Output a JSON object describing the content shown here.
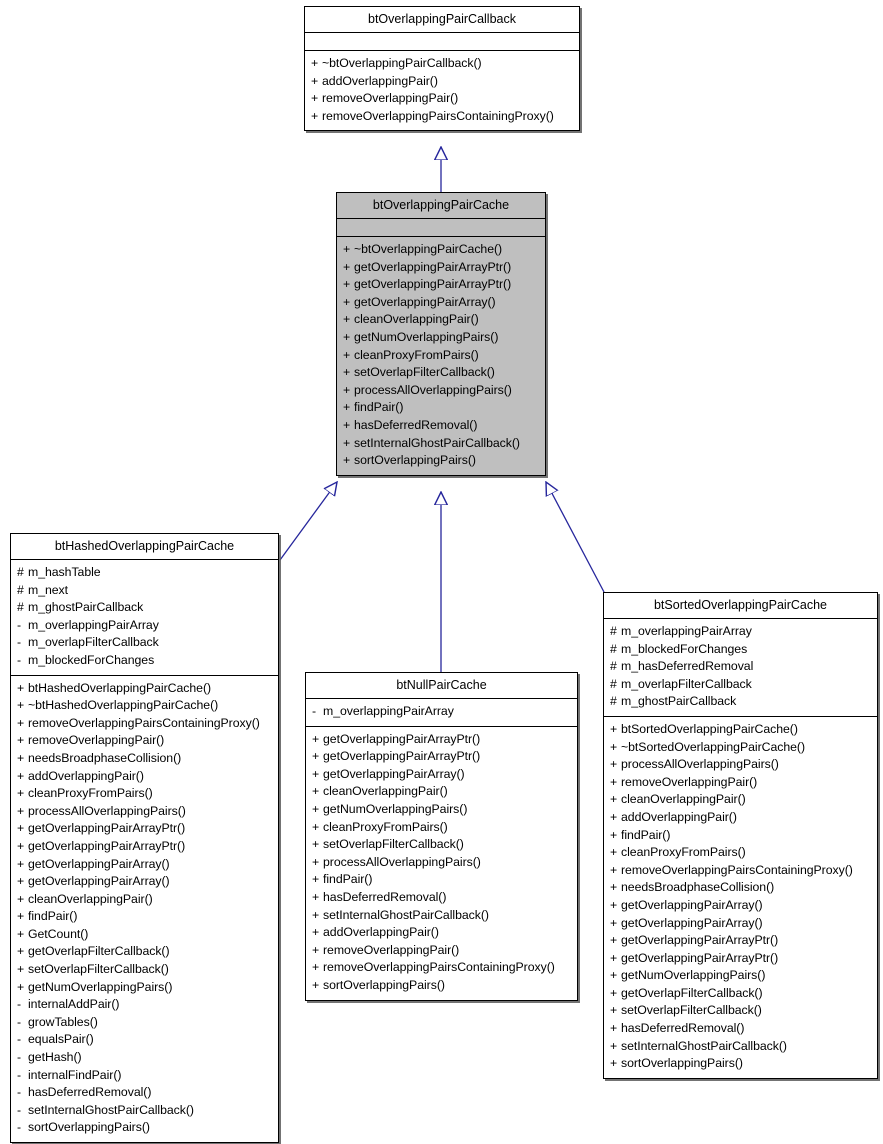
{
  "diagram": {
    "kind": "uml-class-inheritance-diagram",
    "background": "#ffffff",
    "edge_color": "#26269c",
    "highlight_fill": "#bfbfbf",
    "border_color": "#000000"
  },
  "classes": {
    "callback": {
      "name": "btOverlappingPairCallback",
      "attributes": [],
      "methods": [
        {
          "vis": "+",
          "label": "~btOverlappingPairCallback()"
        },
        {
          "vis": "+",
          "label": "addOverlappingPair()"
        },
        {
          "vis": "+",
          "label": "removeOverlappingPair()"
        },
        {
          "vis": "+",
          "label": "removeOverlappingPairsContainingProxy()"
        }
      ]
    },
    "cache": {
      "name": "btOverlappingPairCache",
      "attributes": [],
      "methods": [
        {
          "vis": "+",
          "label": "~btOverlappingPairCache()"
        },
        {
          "vis": "+",
          "label": "getOverlappingPairArrayPtr()"
        },
        {
          "vis": "+",
          "label": "getOverlappingPairArrayPtr()"
        },
        {
          "vis": "+",
          "label": "getOverlappingPairArray()"
        },
        {
          "vis": "+",
          "label": "cleanOverlappingPair()"
        },
        {
          "vis": "+",
          "label": "getNumOverlappingPairs()"
        },
        {
          "vis": "+",
          "label": "cleanProxyFromPairs()"
        },
        {
          "vis": "+",
          "label": "setOverlapFilterCallback()"
        },
        {
          "vis": "+",
          "label": "processAllOverlappingPairs()"
        },
        {
          "vis": "+",
          "label": "findPair()"
        },
        {
          "vis": "+",
          "label": "hasDeferredRemoval()"
        },
        {
          "vis": "+",
          "label": "setInternalGhostPairCallback()"
        },
        {
          "vis": "+",
          "label": "sortOverlappingPairs()"
        }
      ]
    },
    "hashed": {
      "name": "btHashedOverlappingPairCache",
      "attributes": [
        {
          "vis": "#",
          "label": "m_hashTable"
        },
        {
          "vis": "#",
          "label": "m_next"
        },
        {
          "vis": "#",
          "label": "m_ghostPairCallback"
        },
        {
          "vis": "-",
          "label": "m_overlappingPairArray"
        },
        {
          "vis": "-",
          "label": "m_overlapFilterCallback"
        },
        {
          "vis": "-",
          "label": "m_blockedForChanges"
        }
      ],
      "methods": [
        {
          "vis": "+",
          "label": "btHashedOverlappingPairCache()"
        },
        {
          "vis": "+",
          "label": "~btHashedOverlappingPairCache()"
        },
        {
          "vis": "+",
          "label": "removeOverlappingPairsContainingProxy()"
        },
        {
          "vis": "+",
          "label": "removeOverlappingPair()"
        },
        {
          "vis": "+",
          "label": "needsBroadphaseCollision()"
        },
        {
          "vis": "+",
          "label": "addOverlappingPair()"
        },
        {
          "vis": "+",
          "label": "cleanProxyFromPairs()"
        },
        {
          "vis": "+",
          "label": "processAllOverlappingPairs()"
        },
        {
          "vis": "+",
          "label": "getOverlappingPairArrayPtr()"
        },
        {
          "vis": "+",
          "label": "getOverlappingPairArrayPtr()"
        },
        {
          "vis": "+",
          "label": "getOverlappingPairArray()"
        },
        {
          "vis": "+",
          "label": "getOverlappingPairArray()"
        },
        {
          "vis": "+",
          "label": "cleanOverlappingPair()"
        },
        {
          "vis": "+",
          "label": "findPair()"
        },
        {
          "vis": "+",
          "label": "GetCount()"
        },
        {
          "vis": "+",
          "label": "getOverlapFilterCallback()"
        },
        {
          "vis": "+",
          "label": "setOverlapFilterCallback()"
        },
        {
          "vis": "+",
          "label": "getNumOverlappingPairs()"
        },
        {
          "vis": "-",
          "label": "internalAddPair()"
        },
        {
          "vis": "-",
          "label": "growTables()"
        },
        {
          "vis": "-",
          "label": "equalsPair()"
        },
        {
          "vis": "-",
          "label": "getHash()"
        },
        {
          "vis": "-",
          "label": "internalFindPair()"
        },
        {
          "vis": "-",
          "label": "hasDeferredRemoval()"
        },
        {
          "vis": "-",
          "label": "setInternalGhostPairCallback()"
        },
        {
          "vis": "-",
          "label": "sortOverlappingPairs()"
        }
      ]
    },
    "nullcache": {
      "name": "btNullPairCache",
      "attributes": [
        {
          "vis": "-",
          "label": "m_overlappingPairArray"
        }
      ],
      "methods": [
        {
          "vis": "+",
          "label": "getOverlappingPairArrayPtr()"
        },
        {
          "vis": "+",
          "label": "getOverlappingPairArrayPtr()"
        },
        {
          "vis": "+",
          "label": "getOverlappingPairArray()"
        },
        {
          "vis": "+",
          "label": "cleanOverlappingPair()"
        },
        {
          "vis": "+",
          "label": "getNumOverlappingPairs()"
        },
        {
          "vis": "+",
          "label": "cleanProxyFromPairs()"
        },
        {
          "vis": "+",
          "label": "setOverlapFilterCallback()"
        },
        {
          "vis": "+",
          "label": "processAllOverlappingPairs()"
        },
        {
          "vis": "+",
          "label": "findPair()"
        },
        {
          "vis": "+",
          "label": "hasDeferredRemoval()"
        },
        {
          "vis": "+",
          "label": "setInternalGhostPairCallback()"
        },
        {
          "vis": "+",
          "label": "addOverlappingPair()"
        },
        {
          "vis": "+",
          "label": "removeOverlappingPair()"
        },
        {
          "vis": "+",
          "label": "removeOverlappingPairsContainingProxy()"
        },
        {
          "vis": "+",
          "label": "sortOverlappingPairs()"
        }
      ]
    },
    "sorted": {
      "name": "btSortedOverlappingPairCache",
      "attributes": [
        {
          "vis": "#",
          "label": "m_overlappingPairArray"
        },
        {
          "vis": "#",
          "label": "m_blockedForChanges"
        },
        {
          "vis": "#",
          "label": "m_hasDeferredRemoval"
        },
        {
          "vis": "#",
          "label": "m_overlapFilterCallback"
        },
        {
          "vis": "#",
          "label": "m_ghostPairCallback"
        }
      ],
      "methods": [
        {
          "vis": "+",
          "label": "btSortedOverlappingPairCache()"
        },
        {
          "vis": "+",
          "label": "~btSortedOverlappingPairCache()"
        },
        {
          "vis": "+",
          "label": "processAllOverlappingPairs()"
        },
        {
          "vis": "+",
          "label": "removeOverlappingPair()"
        },
        {
          "vis": "+",
          "label": "cleanOverlappingPair()"
        },
        {
          "vis": "+",
          "label": "addOverlappingPair()"
        },
        {
          "vis": "+",
          "label": "findPair()"
        },
        {
          "vis": "+",
          "label": "cleanProxyFromPairs()"
        },
        {
          "vis": "+",
          "label": "removeOverlappingPairsContainingProxy()"
        },
        {
          "vis": "+",
          "label": "needsBroadphaseCollision()"
        },
        {
          "vis": "+",
          "label": "getOverlappingPairArray()"
        },
        {
          "vis": "+",
          "label": "getOverlappingPairArray()"
        },
        {
          "vis": "+",
          "label": "getOverlappingPairArrayPtr()"
        },
        {
          "vis": "+",
          "label": "getOverlappingPairArrayPtr()"
        },
        {
          "vis": "+",
          "label": "getNumOverlappingPairs()"
        },
        {
          "vis": "+",
          "label": "getOverlapFilterCallback()"
        },
        {
          "vis": "+",
          "label": "setOverlapFilterCallback()"
        },
        {
          "vis": "+",
          "label": "hasDeferredRemoval()"
        },
        {
          "vis": "+",
          "label": "setInternalGhostPairCallback()"
        },
        {
          "vis": "+",
          "label": "sortOverlappingPairs()"
        }
      ]
    }
  },
  "inheritance_edges": [
    {
      "from": "btOverlappingPairCache",
      "to": "btOverlappingPairCallback"
    },
    {
      "from": "btHashedOverlappingPairCache",
      "to": "btOverlappingPairCache"
    },
    {
      "from": "btNullPairCache",
      "to": "btOverlappingPairCache"
    },
    {
      "from": "btSortedOverlappingPairCache",
      "to": "btOverlappingPairCache"
    }
  ]
}
